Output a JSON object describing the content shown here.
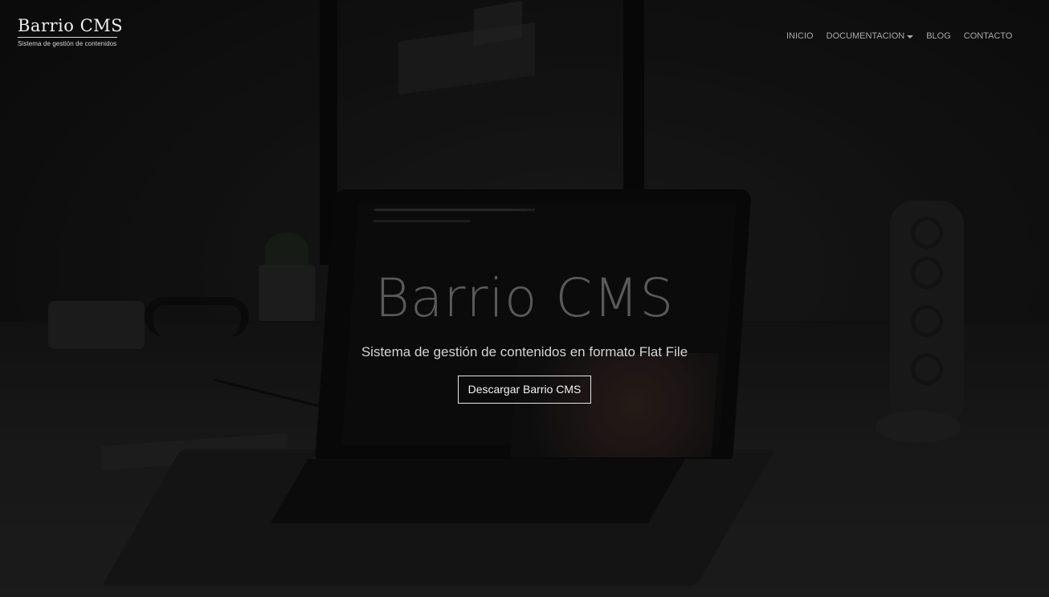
{
  "brand": {
    "title": "Barrio CMS",
    "subtitle": "Sistema de gestión de contenidos"
  },
  "nav": {
    "items": [
      {
        "label": "INICIO"
      },
      {
        "label": "DOCUMENTACION",
        "dropdown": true
      },
      {
        "label": "BLOG"
      },
      {
        "label": "CONTACTO"
      }
    ]
  },
  "hero": {
    "title": "Barrio CMS",
    "subtitle": "Sistema de gestión de contenidos en formato Flat File",
    "button_label": "Descargar Barrio CMS"
  },
  "colors": {
    "background": "#141414",
    "nav_text": "#a9a9a9",
    "hero_title": "#5a5a5a",
    "button_border": "#e6e6e6"
  },
  "icons": {
    "dropdown": "caret-down-icon"
  }
}
